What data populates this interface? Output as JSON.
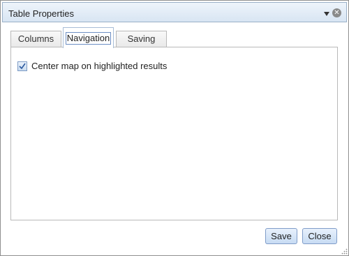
{
  "dialog": {
    "title": "Table Properties",
    "icons": {
      "menu": "chevron-down-icon",
      "close": "close-circle-icon"
    }
  },
  "tabs": [
    {
      "label": "Columns",
      "active": false
    },
    {
      "label": "Navigation",
      "active": true
    },
    {
      "label": "Saving",
      "active": false
    }
  ],
  "navigation": {
    "center_map_label": "Center map on highlighted results",
    "center_map_checked": true
  },
  "buttons": {
    "save": "Save",
    "close": "Close"
  }
}
